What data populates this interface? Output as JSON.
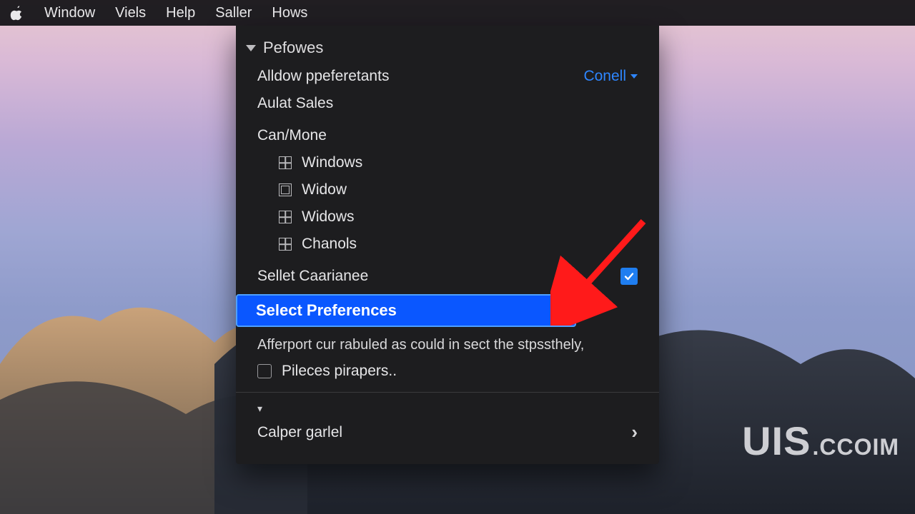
{
  "menubar": {
    "items": [
      "Window",
      "Viels",
      "Help",
      "Saller",
      "Hows"
    ]
  },
  "dropdown": {
    "header": "Pefowes",
    "row_allow": {
      "label": "Alldow ppeferetants",
      "right": "Conell"
    },
    "row_aulat": "Aulat Sales",
    "row_canmone": "Can/Mone",
    "grid_items": [
      "Windows",
      "Widow",
      "Widows",
      "Chanols"
    ],
    "row_sellect_caar": "Sellet Caarianee",
    "selected": "Select Preferences",
    "desc": "Afferport cur rabuled as could in sect the stpssthely,",
    "row_pileces": "Pileces pirapers..",
    "row_calper": "Calper garlel"
  },
  "watermark": {
    "big": "UIS",
    "rest": ".CCOIM"
  }
}
